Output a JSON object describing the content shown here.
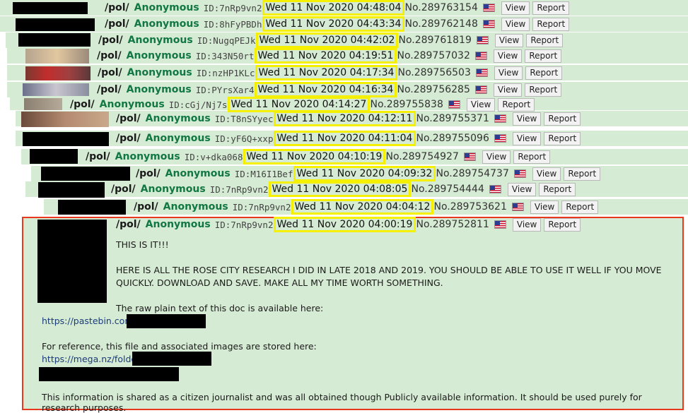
{
  "posts": [
    {
      "board": "/pol/",
      "name": "Anonymous",
      "id": "ID:7nRp9vn2",
      "date": "Wed 11 Nov 2020 04:48:04",
      "no": "No.289763154"
    },
    {
      "board": "/pol/",
      "name": "Anonymous",
      "id": "ID:8hFyPBDh",
      "date": "Wed 11 Nov 2020 04:43:34",
      "no": "No.289762148"
    },
    {
      "board": "/pol/",
      "name": "Anonymous",
      "id": "ID:NugqPEJk",
      "date": "Wed 11 Nov 2020 04:42:02",
      "no": "No.289761819"
    },
    {
      "board": "/pol/",
      "name": "Anonymous",
      "id": "ID:343N50rt",
      "date": "Wed 11 Nov 2020 04:19:51",
      "no": "No.289757032"
    },
    {
      "board": "/pol/",
      "name": "Anonymous",
      "id": "ID:nzHP1KLc",
      "date": "Wed 11 Nov 2020 04:17:34",
      "no": "No.289756503"
    },
    {
      "board": "/pol/",
      "name": "Anonymous",
      "id": "ID:PYrsXar4",
      "date": "Wed 11 Nov 2020 04:16:34",
      "no": "No.289756285"
    },
    {
      "board": "/pol/",
      "name": "Anonymous",
      "id": "ID:cGj/Nj7s",
      "date": "Wed 11 Nov 2020 04:14:27",
      "no": "No.289755838"
    },
    {
      "board": "/pol/",
      "name": "Anonymous",
      "id": "ID:T8nSYyec",
      "date": "Wed 11 Nov 2020 04:12:11",
      "no": "No.289755371"
    },
    {
      "board": "/pol/",
      "name": "Anonymous",
      "id": "ID:yF6Q+xxp",
      "date": "Wed 11 Nov 2020 04:11:04",
      "no": "No.289755096"
    },
    {
      "board": "/pol/",
      "name": "Anonymous",
      "id": "ID:v+dka068",
      "date": "Wed 11 Nov 2020 04:10:19",
      "no": "No.289754927"
    },
    {
      "board": "/pol/",
      "name": "Anonymous",
      "id": "ID:M16I1Bef",
      "date": "Wed 11 Nov 2020 04:09:32",
      "no": "No.289754737"
    },
    {
      "board": "/pol/",
      "name": "Anonymous",
      "id": "ID:7nRp9vn2",
      "date": "Wed 11 Nov 2020 04:08:05",
      "no": "No.289754444"
    },
    {
      "board": "/pol/",
      "name": "Anonymous",
      "id": "ID:7nRp9vn2",
      "date": "Wed 11 Nov 2020 04:04:12",
      "no": "No.289753621"
    },
    {
      "board": "/pol/",
      "name": "Anonymous",
      "id": "ID:7nRp9vn2",
      "date": "Wed 11 Nov 2020 04:00:19",
      "no": "No.289752811"
    }
  ],
  "buttons": {
    "view": "View",
    "report": "Report"
  },
  "op_text": {
    "line1": "THIS IS IT!!!",
    "line2": "HERE IS ALL THE ROSE CITY RESEARCH I DID IN LATE 2018 AND 2019. YOU SHOULD BE ABLE TO USE IT WELL IF YOU MOVE",
    "line3": "QUICKLY. DOWNLOAD AND SAVE. MAKE ALL MY TIME WORTH SOMETHING.",
    "line4": "The raw plain text of this doc is available here:",
    "link1": "https://pastebin.com/",
    "line5": "For reference, this file and associated images are stored here:",
    "link2": "https://mega.nz/folder/",
    "line6": "This information is shared as a citizen journalist and was all obtained though Publicly available information. It should be used purely for research purposes."
  },
  "colors": {
    "name": "#117743",
    "post_bg": "#d6ebd4",
    "highlight": "#f5f000",
    "op_border": "#e8391f"
  }
}
